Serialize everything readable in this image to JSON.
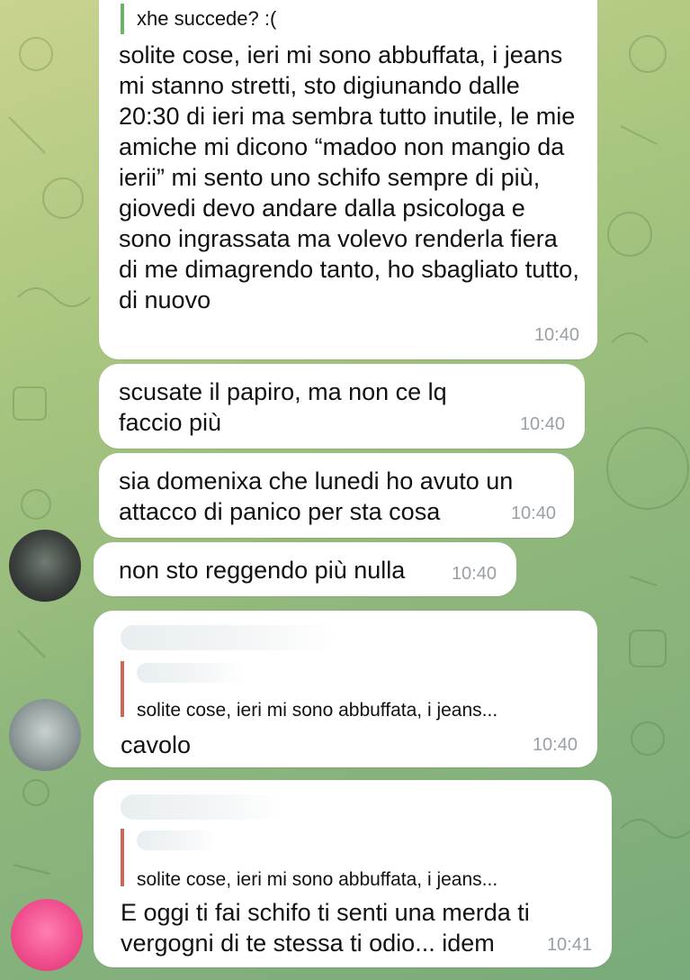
{
  "messages": [
    {
      "reply_quote": "xhe succede? :(",
      "text": "solite cose, ieri mi sono abbuffata, i jeans mi stanno stretti, sto digiunando dalle 20:30 di ieri ma sembra tutto inutile, le mie amiche mi dicono “madoo non mangio da ierii” mi sento uno schifo sempre di più, giovedi devo andare dalla psicologa e sono ingrassata ma volevo renderla fiera di me dimagrendo tanto, ho sbagliato tutto, di nuovo",
      "time": "10:40"
    },
    {
      "text": "scusate il papiro, ma non ce lq faccio più",
      "time": "10:40"
    },
    {
      "text": "sia domenixa che lunedi ho avuto un attacco di panico per sta cosa",
      "time": "10:40"
    },
    {
      "text": "non sto reggendo più nulla",
      "time": "10:40"
    },
    {
      "reply_quote": "solite cose, ieri mi sono abbuffata, i jeans...",
      "text": "cavolo",
      "time": "10:40"
    },
    {
      "reply_quote": "solite cose, ieri mi sono abbuffata, i jeans...",
      "text": "E oggi ti fai schifo ti senti una merda ti vergogni di te stessa ti odio... idem",
      "time": "10:41"
    }
  ],
  "colors": {
    "bubble_bg": "#ffffff",
    "reply_bar": "#c66a5a",
    "timestamp": "#9aa0a6"
  },
  "icons": [
    "chat-wallpaper-doodles",
    "avatar-blurred",
    "avatar-pink-blurred"
  ]
}
